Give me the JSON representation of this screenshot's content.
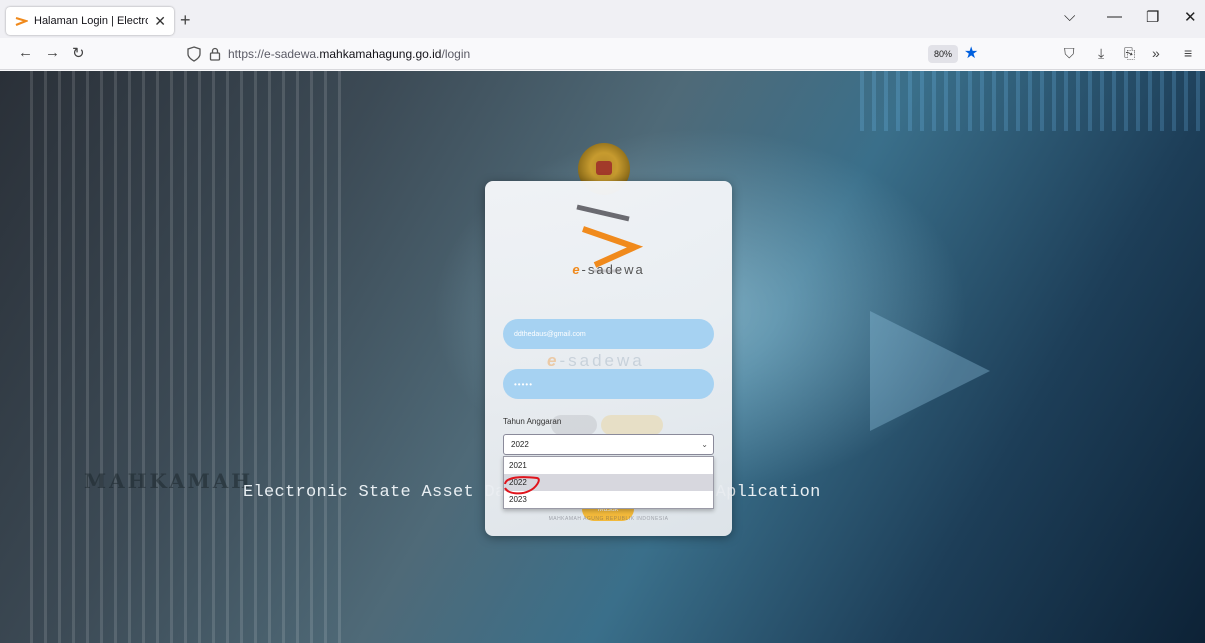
{
  "browser": {
    "tab_title": "Halaman Login | Electronic State",
    "tab_close": "✕",
    "new_tab": "+",
    "url_prefix": "https://e-sadewa.",
    "url_domain": "mahkamahagung.go.id",
    "url_path": "/login",
    "zoom": "80%",
    "window_controls": [
      "⌵",
      "—",
      "❐",
      "✕"
    ],
    "nav": {
      "back": "←",
      "forward": "→",
      "reload": "↻"
    },
    "right_tools": [
      "⛉",
      "⤓",
      "⎘",
      "»",
      "≡"
    ]
  },
  "page": {
    "bg_org": "MAHKAMAH",
    "app_title": "Electronic State Asset Data Enhancement Work Aplication",
    "logo_prefix": "e",
    "logo_suffix": "-sadewa",
    "email_value": "ddthedaus@gmail.com",
    "password_mask": "•••••",
    "year_label": "Tahun Anggaran",
    "year_selected": "2022",
    "year_options": [
      "2021",
      "2022",
      "2023"
    ],
    "submit_label": "Masuk",
    "footer_text": "MAHKAMAH AGUNG REPUBLIK INDONESIA"
  },
  "colors": {
    "field_bg": "#a6d2f2",
    "submit_bg": "#f2b93b",
    "logo_orange": "#f08a1c",
    "bookmark_star": "#0060df",
    "annotation": "#e0141c"
  },
  "icons": [
    "sadewa-favicon-icon",
    "shield-icon",
    "lock-icon",
    "star-icon",
    "chevron-down-icon"
  ]
}
